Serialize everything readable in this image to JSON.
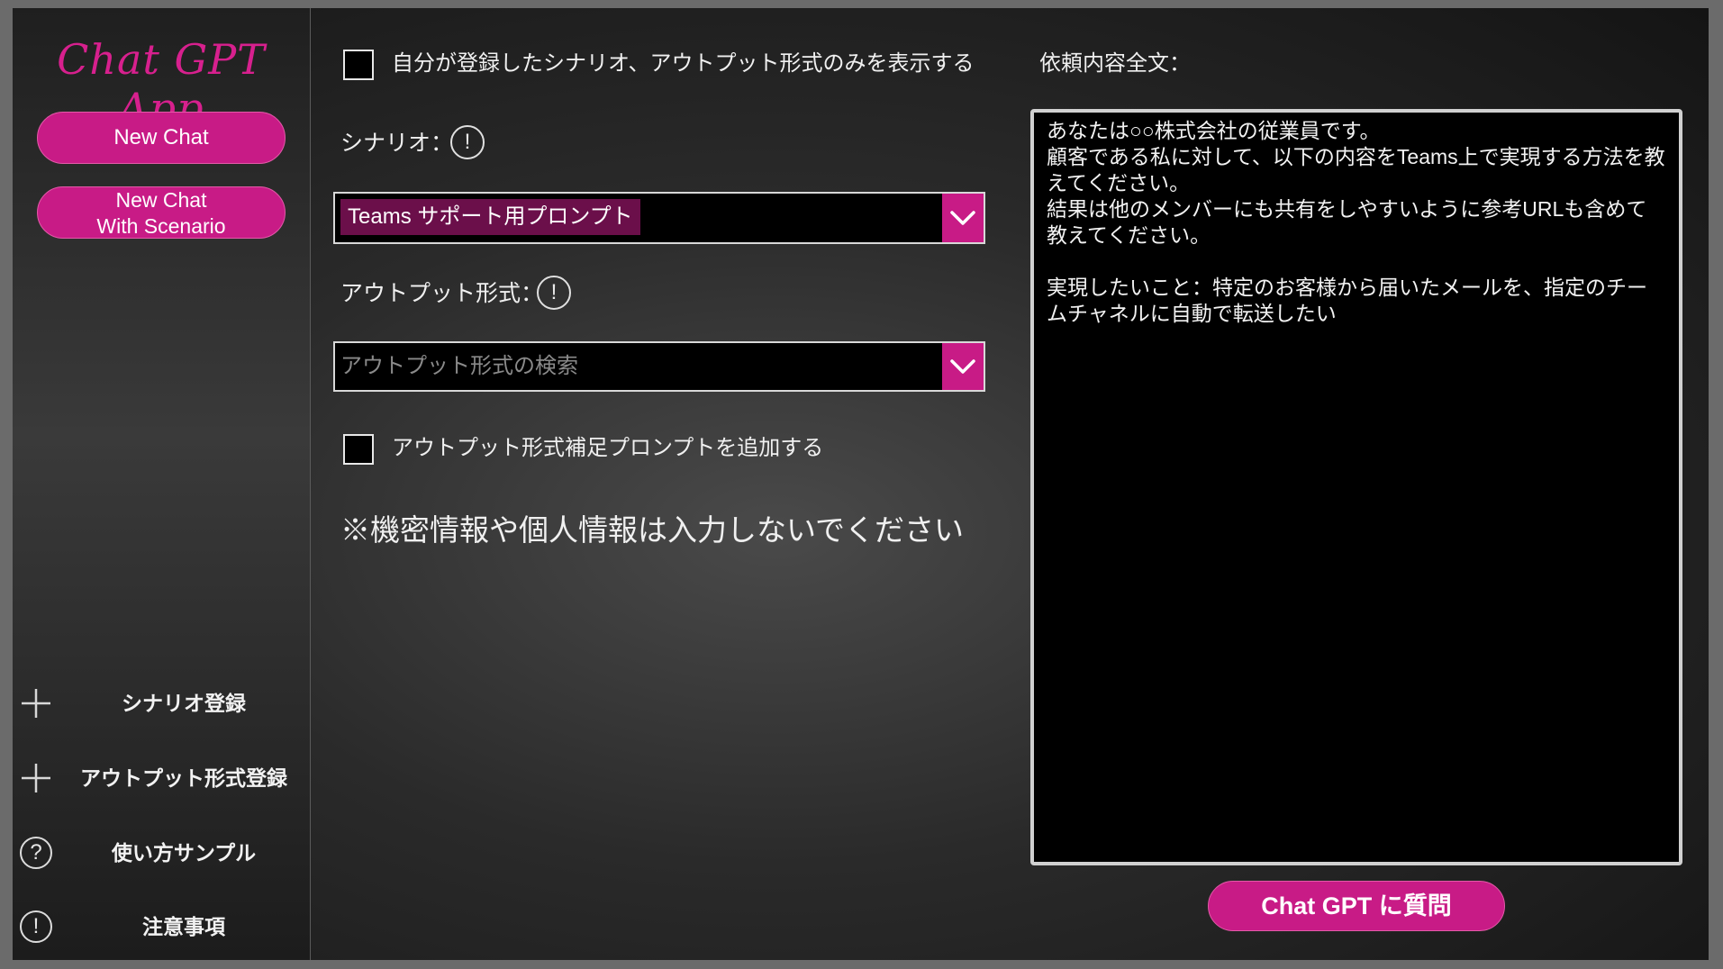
{
  "app": {
    "logo": "Chat GPT App"
  },
  "sidebar": {
    "new_chat": "New Chat",
    "new_chat_scenario_line1": "New Chat",
    "new_chat_scenario_line2": "With Scenario",
    "items": [
      {
        "label": "シナリオ登録",
        "icon": "plus-icon"
      },
      {
        "label": "アウトプット形式登録",
        "icon": "plus-icon"
      },
      {
        "label": "使い方サンプル",
        "icon": "question-circle-icon",
        "glyph": "?"
      },
      {
        "label": "注意事項",
        "icon": "exclamation-circle-icon",
        "glyph": "!"
      }
    ]
  },
  "form": {
    "only_mine_label": "自分が登録したシナリオ、アウトプット形式のみを表示する",
    "scenario_label": "シナリオ：",
    "scenario_selected": "Teams サポート用プロンプト",
    "output_label": "アウトプット形式：",
    "output_placeholder": "アウトプット形式の検索",
    "add_supplement_label": "アウトプット形式補足プロンプトを追加する",
    "warning": "※機密情報や個人情報は入力しないでください",
    "info_glyph": "!"
  },
  "request": {
    "label": "依頼内容全文：",
    "text": "あなたは○○株式会社の従業員です。\n顧客である私に対して、以下の内容をTeams上で実現する方法を教えてください。\n結果は他のメンバーにも共有をしやすいように参考URLも含めて教えてください。\n\n実現したいこと：特定のお客様から届いたメールを、指定のチームチャネルに自動で転送したい",
    "ask_button": "Chat GPT に質問"
  },
  "colors": {
    "accent": "#c81b86",
    "accent_dark": "#6b0f4a",
    "logo": "#d7208e"
  }
}
